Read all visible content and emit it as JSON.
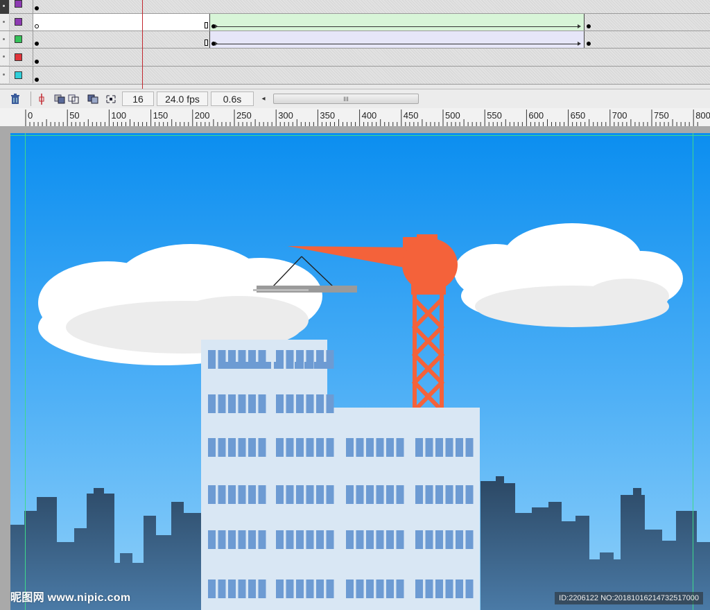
{
  "timeline": {
    "layers": [
      {
        "color": "#8e3bb3",
        "row": 0,
        "frames_left_keyframe": true
      },
      {
        "color": "#8e3bb3",
        "row": 1
      },
      {
        "color": "#36c25a",
        "row": 2
      },
      {
        "color": "#e0353b",
        "row": 3
      },
      {
        "color": "#30cfd9",
        "row": 4
      }
    ],
    "current_frame": "16",
    "fps": "24.0 fps",
    "elapsed": "0.6s",
    "scroll_label": "III"
  },
  "ruler": {
    "ticks": [
      "0",
      "50",
      "100",
      "150",
      "200",
      "250",
      "300",
      "350",
      "400",
      "450",
      "500",
      "550",
      "600",
      "650",
      "700",
      "750",
      "800"
    ]
  },
  "stage": {
    "sky_top": "#0a8ff0",
    "sky_bottom": "#7fc8f8",
    "crane_color": "#f4623a",
    "building_color": "#d8e6f3",
    "window_color": "#6d9bd3",
    "skyline_color": "#2e4d6d"
  },
  "watermark": {
    "left": "昵图网 www.nipic.com",
    "right": "ID:2206122 NO:20181016214732517000"
  }
}
